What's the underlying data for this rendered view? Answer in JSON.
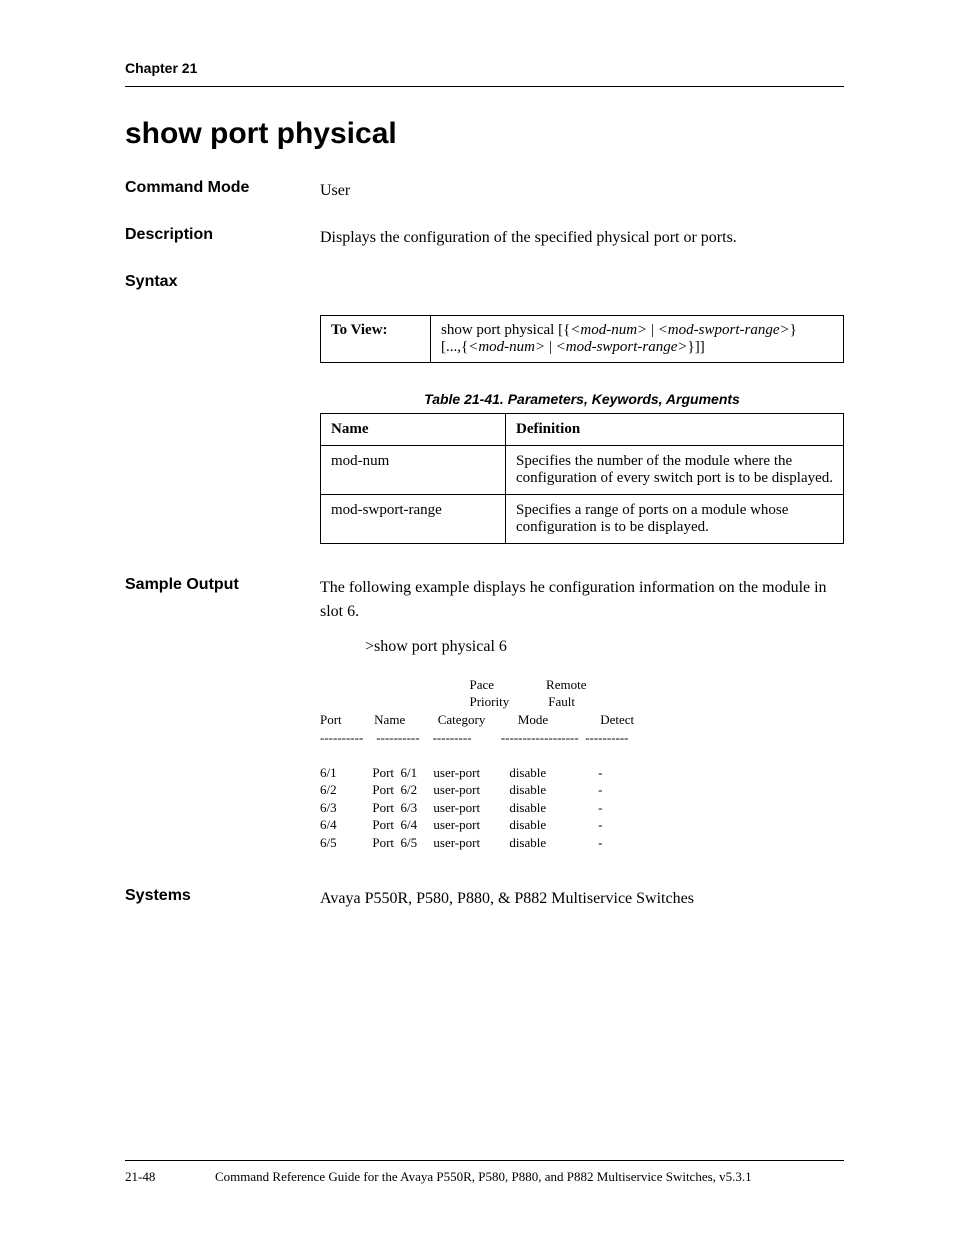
{
  "chapter": "Chapter 21",
  "title": "show port physical",
  "commandMode": {
    "label": "Command Mode",
    "value": "User"
  },
  "description": {
    "label": "Description",
    "value": "Displays the configuration of the specified physical port or ports."
  },
  "syntax": {
    "label": "Syntax",
    "toViewLabel": "To View:",
    "cmd_prefix": "show port physical [{",
    "arg1": "<mod-num>",
    "sep1": " | ",
    "arg2": "<mod-swport-range>",
    "suffix1": "}",
    "line2_prefix": "[...,{",
    "arg3": "<mod-num>",
    "sep2": " | ",
    "arg4": "<mod-swport-range>",
    "suffix2": "}]]"
  },
  "paramTable": {
    "caption": "Table 21-41.  Parameters, Keywords, Arguments",
    "headers": {
      "name": "Name",
      "definition": "Definition"
    },
    "rows": [
      {
        "name": "mod-num",
        "definition": "Specifies the number of the module where the configuration of every switch port is to be displayed."
      },
      {
        "name": "mod-swport-range",
        "definition": "Specifies a range of ports on a module whose configuration is to be displayed."
      }
    ]
  },
  "sampleOutput": {
    "label": "Sample Output",
    "intro": "The following example displays he configuration information on the module in slot 6.",
    "command": ">show port physical 6",
    "columns": {
      "port": "Port",
      "name": "Name",
      "category": "Category",
      "pace1": "Pace",
      "pace2": "Priority",
      "pace3": "Mode",
      "remote1": "Remote",
      "remote2": "Fault",
      "remote3": "Detect"
    },
    "dashes": {
      "port": "----------",
      "name": "----------",
      "category": "---------",
      "pace": "------------------",
      "remote": "----------"
    },
    "rows": [
      {
        "port": "6/1",
        "name": "Port  6/1",
        "category": "user-port",
        "pace": "disable",
        "remote": "-"
      },
      {
        "port": "6/2",
        "name": "Port  6/2",
        "category": "user-port",
        "pace": "disable",
        "remote": "-"
      },
      {
        "port": "6/3",
        "name": "Port  6/3",
        "category": "user-port",
        "pace": "disable",
        "remote": "-"
      },
      {
        "port": "6/4",
        "name": "Port  6/4",
        "category": "user-port",
        "pace": "disable",
        "remote": "-"
      },
      {
        "port": "6/5",
        "name": "Port  6/5",
        "category": "user-port",
        "pace": "disable",
        "remote": "-"
      }
    ]
  },
  "systems": {
    "label": "Systems",
    "value": "Avaya P550R, P580, P880, & P882 Multiservice Switches"
  },
  "footer": {
    "pageNum": "21-48",
    "title": "Command Reference Guide for the Avaya P550R, P580, P880, and P882 Multiservice Switches, v5.3.1"
  }
}
